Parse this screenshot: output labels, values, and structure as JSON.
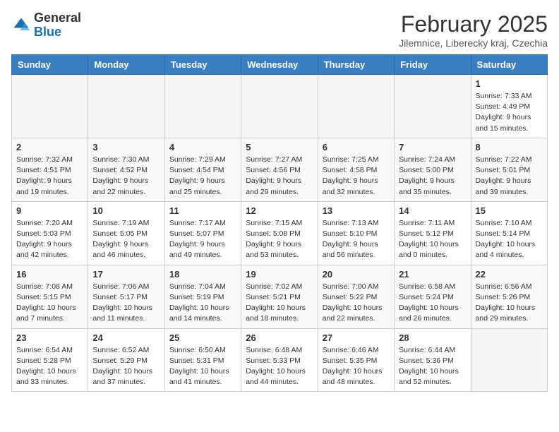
{
  "header": {
    "logo_general": "General",
    "logo_blue": "Blue",
    "month_title": "February 2025",
    "location": "Jilemnice, Liberecky kraj, Czechia"
  },
  "days_of_week": [
    "Sunday",
    "Monday",
    "Tuesday",
    "Wednesday",
    "Thursday",
    "Friday",
    "Saturday"
  ],
  "weeks": [
    [
      {
        "day": "",
        "info": ""
      },
      {
        "day": "",
        "info": ""
      },
      {
        "day": "",
        "info": ""
      },
      {
        "day": "",
        "info": ""
      },
      {
        "day": "",
        "info": ""
      },
      {
        "day": "",
        "info": ""
      },
      {
        "day": "1",
        "info": "Sunrise: 7:33 AM\nSunset: 4:49 PM\nDaylight: 9 hours and 15 minutes."
      }
    ],
    [
      {
        "day": "2",
        "info": "Sunrise: 7:32 AM\nSunset: 4:51 PM\nDaylight: 9 hours and 19 minutes."
      },
      {
        "day": "3",
        "info": "Sunrise: 7:30 AM\nSunset: 4:52 PM\nDaylight: 9 hours and 22 minutes."
      },
      {
        "day": "4",
        "info": "Sunrise: 7:29 AM\nSunset: 4:54 PM\nDaylight: 9 hours and 25 minutes."
      },
      {
        "day": "5",
        "info": "Sunrise: 7:27 AM\nSunset: 4:56 PM\nDaylight: 9 hours and 29 minutes."
      },
      {
        "day": "6",
        "info": "Sunrise: 7:25 AM\nSunset: 4:58 PM\nDaylight: 9 hours and 32 minutes."
      },
      {
        "day": "7",
        "info": "Sunrise: 7:24 AM\nSunset: 5:00 PM\nDaylight: 9 hours and 35 minutes."
      },
      {
        "day": "8",
        "info": "Sunrise: 7:22 AM\nSunset: 5:01 PM\nDaylight: 9 hours and 39 minutes."
      }
    ],
    [
      {
        "day": "9",
        "info": "Sunrise: 7:20 AM\nSunset: 5:03 PM\nDaylight: 9 hours and 42 minutes."
      },
      {
        "day": "10",
        "info": "Sunrise: 7:19 AM\nSunset: 5:05 PM\nDaylight: 9 hours and 46 minutes."
      },
      {
        "day": "11",
        "info": "Sunrise: 7:17 AM\nSunset: 5:07 PM\nDaylight: 9 hours and 49 minutes."
      },
      {
        "day": "12",
        "info": "Sunrise: 7:15 AM\nSunset: 5:08 PM\nDaylight: 9 hours and 53 minutes."
      },
      {
        "day": "13",
        "info": "Sunrise: 7:13 AM\nSunset: 5:10 PM\nDaylight: 9 hours and 56 minutes."
      },
      {
        "day": "14",
        "info": "Sunrise: 7:11 AM\nSunset: 5:12 PM\nDaylight: 10 hours and 0 minutes."
      },
      {
        "day": "15",
        "info": "Sunrise: 7:10 AM\nSunset: 5:14 PM\nDaylight: 10 hours and 4 minutes."
      }
    ],
    [
      {
        "day": "16",
        "info": "Sunrise: 7:08 AM\nSunset: 5:15 PM\nDaylight: 10 hours and 7 minutes."
      },
      {
        "day": "17",
        "info": "Sunrise: 7:06 AM\nSunset: 5:17 PM\nDaylight: 10 hours and 11 minutes."
      },
      {
        "day": "18",
        "info": "Sunrise: 7:04 AM\nSunset: 5:19 PM\nDaylight: 10 hours and 14 minutes."
      },
      {
        "day": "19",
        "info": "Sunrise: 7:02 AM\nSunset: 5:21 PM\nDaylight: 10 hours and 18 minutes."
      },
      {
        "day": "20",
        "info": "Sunrise: 7:00 AM\nSunset: 5:22 PM\nDaylight: 10 hours and 22 minutes."
      },
      {
        "day": "21",
        "info": "Sunrise: 6:58 AM\nSunset: 5:24 PM\nDaylight: 10 hours and 26 minutes."
      },
      {
        "day": "22",
        "info": "Sunrise: 6:56 AM\nSunset: 5:26 PM\nDaylight: 10 hours and 29 minutes."
      }
    ],
    [
      {
        "day": "23",
        "info": "Sunrise: 6:54 AM\nSunset: 5:28 PM\nDaylight: 10 hours and 33 minutes."
      },
      {
        "day": "24",
        "info": "Sunrise: 6:52 AM\nSunset: 5:29 PM\nDaylight: 10 hours and 37 minutes."
      },
      {
        "day": "25",
        "info": "Sunrise: 6:50 AM\nSunset: 5:31 PM\nDaylight: 10 hours and 41 minutes."
      },
      {
        "day": "26",
        "info": "Sunrise: 6:48 AM\nSunset: 5:33 PM\nDaylight: 10 hours and 44 minutes."
      },
      {
        "day": "27",
        "info": "Sunrise: 6:46 AM\nSunset: 5:35 PM\nDaylight: 10 hours and 48 minutes."
      },
      {
        "day": "28",
        "info": "Sunrise: 6:44 AM\nSunset: 5:36 PM\nDaylight: 10 hours and 52 minutes."
      },
      {
        "day": "",
        "info": ""
      }
    ]
  ]
}
